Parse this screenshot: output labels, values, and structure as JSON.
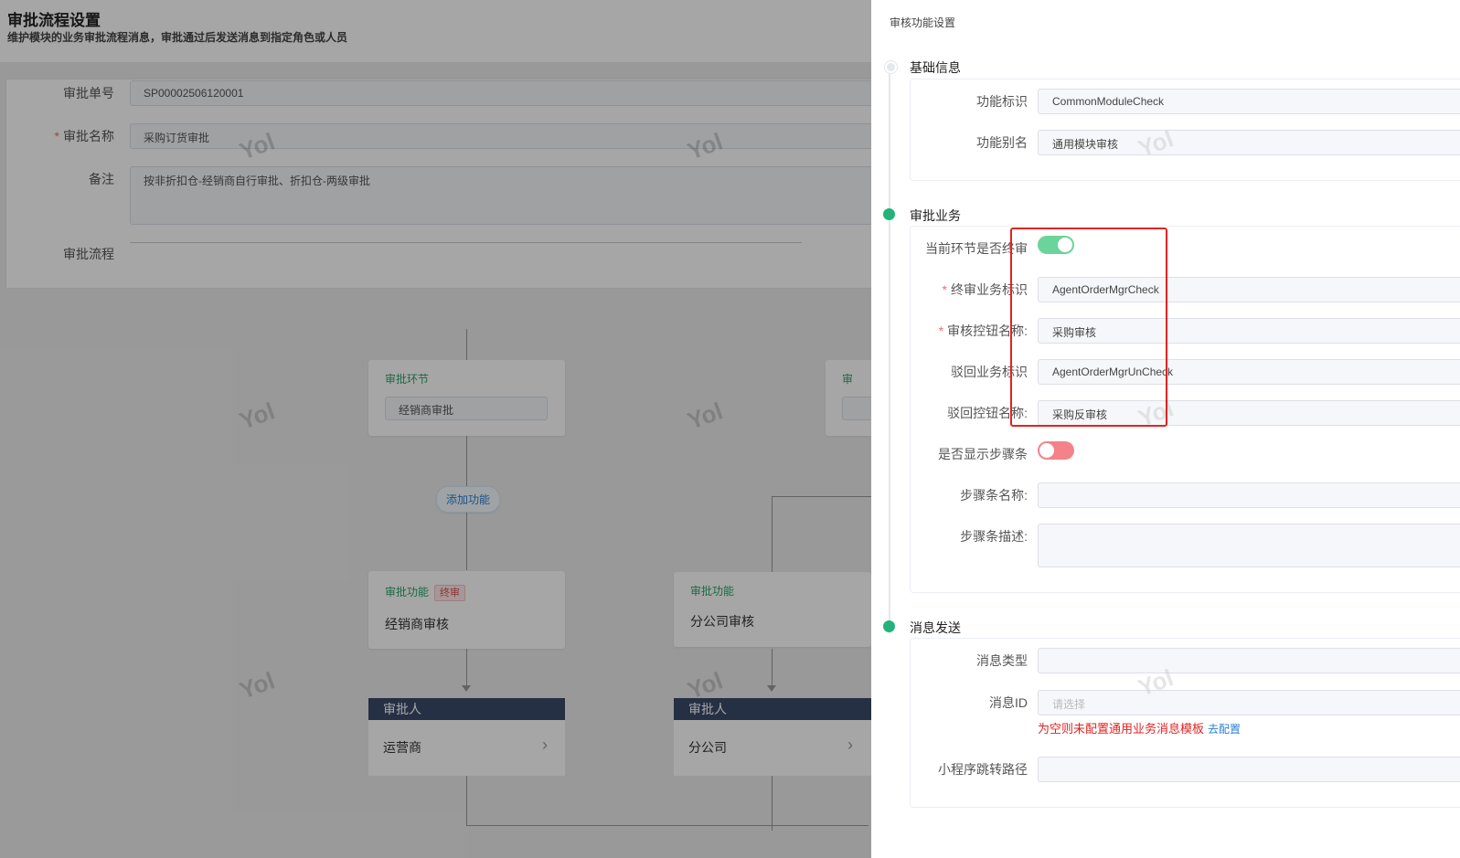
{
  "page": {
    "title": "审批流程设置",
    "subtitle": "维护模块的业务审批流程消息，审批通过后发送消息到指定角色或人员"
  },
  "form": {
    "no_label": "审批单号",
    "no_value": "SP00002506120001",
    "name_label": "审批名称",
    "name_value": "采购订货审批",
    "remark_label": "备注",
    "remark_value": "按非折扣仓-经销商自行审批、折扣仓-两级审批",
    "flow_label": "审批流程",
    "required_mark": "*"
  },
  "flow": {
    "step_tag": "审批环节",
    "step_value": "经销商审批",
    "step_tag_partial": "审",
    "add_button": "添加功能",
    "func_tag": "审批功能",
    "end_tag": "终审",
    "func1_name": "经销商审核",
    "func2_name": "分公司审核",
    "approver_head": "审批人",
    "approver1": "运营商",
    "approver2": "分公司",
    "chevron": "›"
  },
  "watermark": "Yol",
  "drawer": {
    "title": "审核功能设置",
    "basic": {
      "section": "基础信息",
      "id_label": "功能标识",
      "id_value": "CommonModuleCheck",
      "alias_label": "功能别名",
      "alias_value": "通用模块审核"
    },
    "business": {
      "section": "审批业务",
      "final_label": "当前环节是否终审",
      "final_on": true,
      "final_id_label": "终审业务标识",
      "final_id_value": "AgentOrderMgrCheck",
      "check_btn_label": "审核控钮名称:",
      "check_btn_value": "采购审核",
      "reject_id_label": "驳回业务标识",
      "reject_id_value": "AgentOrderMgrUnCheck",
      "reject_btn_label": "驳回控钮名称:",
      "reject_btn_value": "采购反审核",
      "steps_label": "是否显示步骤条",
      "steps_on": false,
      "steps_name_label": "步骤条名称:",
      "steps_name_value": "",
      "steps_desc_label": "步骤条描述:",
      "steps_desc_value": "",
      "required_mark": "*"
    },
    "message": {
      "section": "消息发送",
      "type_label": "消息类型",
      "type_value": "",
      "id_label": "消息ID",
      "id_placeholder": "请选择",
      "hint": "为空则未配置通用业务消息模板",
      "hint_link": "去配置",
      "path_label": "小程序跳转路径",
      "path_value": ""
    }
  },
  "colors": {
    "accent_green": "#23b37a",
    "switch_on": "#6ad49a",
    "switch_off": "#f3828a",
    "highlight_red": "#e42222",
    "link_blue": "#2b7fd4",
    "approver_header": "#3a4a6b"
  }
}
